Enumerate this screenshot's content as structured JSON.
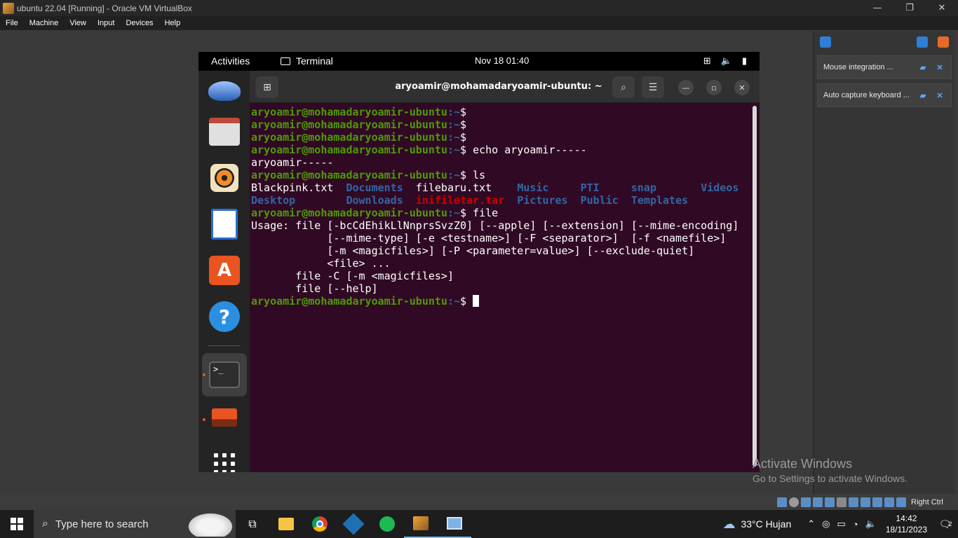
{
  "vbox": {
    "title": "ubuntu 22.04 [Running] - Oracle VM VirtualBox",
    "menu": [
      "File",
      "Machine",
      "View",
      "Input",
      "Devices",
      "Help"
    ],
    "minimize_glyph": "—",
    "restore_glyph": "❐",
    "close_glyph": "✕",
    "notifications": [
      {
        "text": "Mouse integration ..."
      },
      {
        "text": "Auto capture keyboard ..."
      }
    ],
    "status_right": "Right Ctrl"
  },
  "gnome": {
    "activities": "Activities",
    "app_name": "Terminal",
    "clock": "Nov 18  01:40"
  },
  "terminal": {
    "title": "aryoamir@mohamadaryoamir-ubuntu: ~",
    "prompt_user": "aryoamir@mohamadaryoamir-ubuntu",
    "prompt_path": ":~",
    "prompt_symbol": "$",
    "lines": [
      {
        "type": "prompt",
        "cmd": ""
      },
      {
        "type": "prompt",
        "cmd": ""
      },
      {
        "type": "prompt",
        "cmd": ""
      },
      {
        "type": "prompt",
        "cmd": " echo aryoamir-----"
      },
      {
        "type": "out",
        "text": "aryoamir-----"
      },
      {
        "type": "prompt",
        "cmd": " ls"
      },
      {
        "type": "ls",
        "items": [
          {
            "text": "Blackpink.txt",
            "kind": "file"
          },
          {
            "text": "Documents",
            "kind": "dir"
          },
          {
            "text": "filebaru.txt",
            "kind": "file"
          },
          {
            "text": "Music",
            "kind": "dir"
          },
          {
            "text": "PTI",
            "kind": "dir"
          },
          {
            "text": "snap",
            "kind": "dir"
          },
          {
            "text": "Videos",
            "kind": "dir"
          }
        ]
      },
      {
        "type": "ls",
        "items": [
          {
            "text": "Desktop",
            "kind": "dir"
          },
          {
            "text": "Downloads",
            "kind": "dir"
          },
          {
            "text": "inifiletar.tar",
            "kind": "archive"
          },
          {
            "text": "Pictures",
            "kind": "dir"
          },
          {
            "text": "Public",
            "kind": "dir"
          },
          {
            "text": "Templates",
            "kind": "dir"
          }
        ]
      },
      {
        "type": "prompt",
        "cmd": " file"
      },
      {
        "type": "out",
        "text": "Usage: file [-bcCdEhikLlNnprsSvzZ0] [--apple] [--extension] [--mime-encoding]"
      },
      {
        "type": "out",
        "text": "            [--mime-type] [-e <testname>] [-F <separator>]  [-f <namefile>]"
      },
      {
        "type": "out",
        "text": "            [-m <magicfiles>] [-P <parameter=value>] [--exclude-quiet]"
      },
      {
        "type": "out",
        "text": "            <file> ..."
      },
      {
        "type": "out",
        "text": "       file -C [-m <magicfiles>]"
      },
      {
        "type": "out",
        "text": "       file [--help]"
      },
      {
        "type": "prompt_cursor",
        "cmd": " "
      }
    ]
  },
  "windows": {
    "activate_title": "Activate Windows",
    "activate_sub": "Go to Settings to activate Windows.",
    "search_placeholder": "Type here to search",
    "weather": "33°C  Hujan",
    "time": "14:42",
    "date": "18/11/2023",
    "notif_count": "2"
  },
  "colors": {
    "terminal_bg": "#300a24",
    "prompt_green": "#8ae234",
    "dir_blue": "#3465a4",
    "archive_red": "#ef2929"
  }
}
